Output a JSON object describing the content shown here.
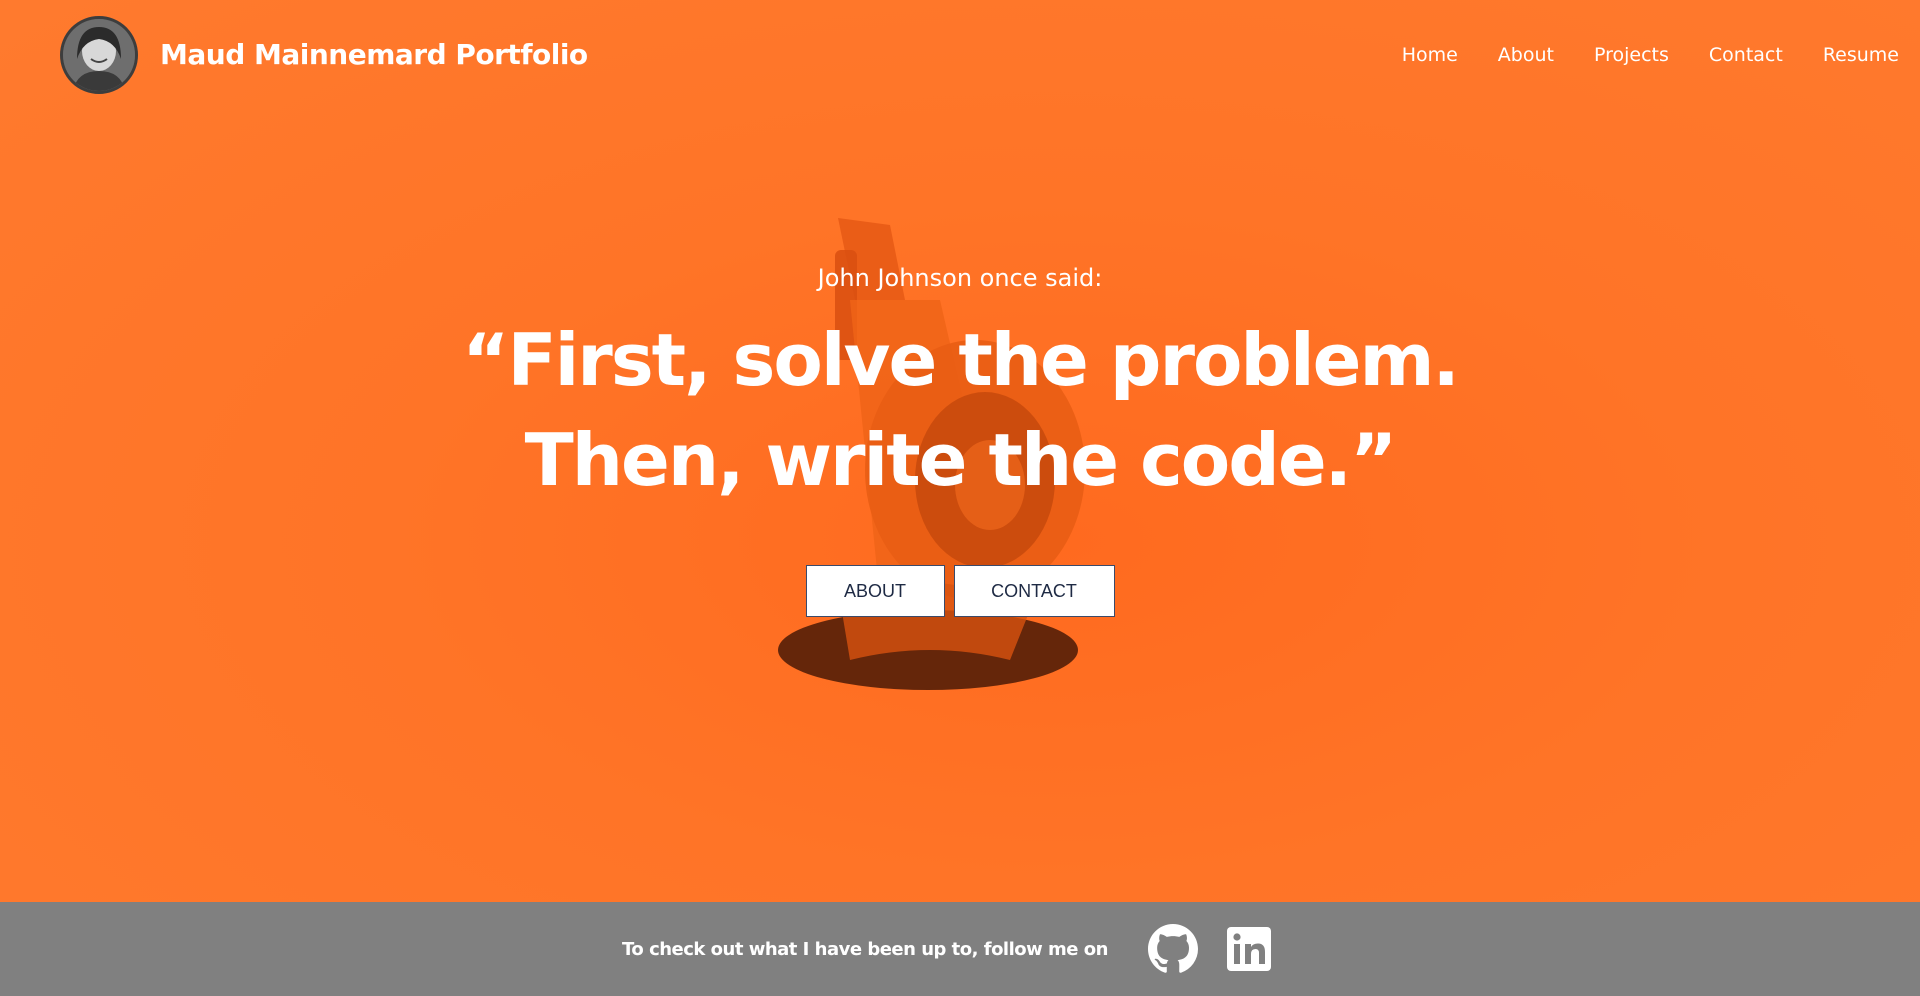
{
  "header": {
    "brand": "Maud Mainnemard Portfolio",
    "nav": [
      "Home",
      "About",
      "Projects",
      "Contact",
      "Resume"
    ]
  },
  "hero": {
    "attribution": "John Johnson once said:",
    "quote_line1": "“First, solve the problem.",
    "quote_line2": "Then, write the code.”",
    "buttons": {
      "about": "ABOUT",
      "contact": "CONTACT"
    }
  },
  "footer": {
    "text": "To check out what I have been up to, follow me on",
    "icons": [
      "github-icon",
      "linkedin-icon"
    ]
  },
  "colors": {
    "background": "#ff7228",
    "footer": "#808080",
    "text": "#ffffff",
    "button_text": "#1e2a44"
  }
}
